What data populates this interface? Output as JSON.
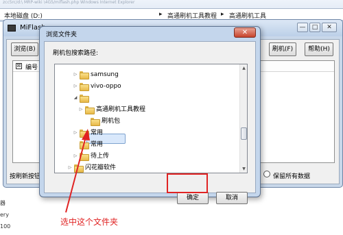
{
  "background": {
    "url_text": "zcc5rc/d:\\ MRP-wiki \\4G5/miflash.php   Windows Internet Explorer",
    "address_parts": [
      "本地磁盘 (D:)",
      "▸",
      "高通刷机工具教程",
      "▸",
      "高通刷机工具"
    ],
    "side_text": [
      "器",
      "ery",
      "100"
    ]
  },
  "miflash": {
    "title": "MiFlash",
    "controls": [
      "—",
      "□",
      "✕"
    ],
    "browse_button": "浏览(B)",
    "flash_button": "刷机(F)",
    "help_button": "帮助(H)",
    "list_header_check": "☒",
    "list_header_col": "编号",
    "status_left": "按刷新按钮",
    "status_right": "保留所有数据"
  },
  "dialog": {
    "title": "浏览文件夹",
    "close": "✕",
    "prompt": "刷机包搜索路径:",
    "tree": [
      {
        "label": "samsung",
        "expander": "▷"
      },
      {
        "label": "vivo-oppo",
        "expander": "▷"
      },
      {
        "label": "",
        "expander": "◢"
      },
      {
        "label": "高通刷机工具教程",
        "expander": "▷"
      },
      {
        "label": "刷机包",
        "expander": "",
        "selected": true
      },
      {
        "label": "常用",
        "expander": "▷"
      },
      {
        "label": "常用",
        "expander": ""
      },
      {
        "label": "待上传",
        "expander": "▷"
      },
      {
        "label": "闪花瓣软件",
        "expander": "▷"
      }
    ],
    "ok": "确定",
    "cancel": "取消"
  },
  "annotation": "选中这个文件夹",
  "colors": {
    "accent": "#e02222",
    "selection": "#d9e8fb"
  }
}
